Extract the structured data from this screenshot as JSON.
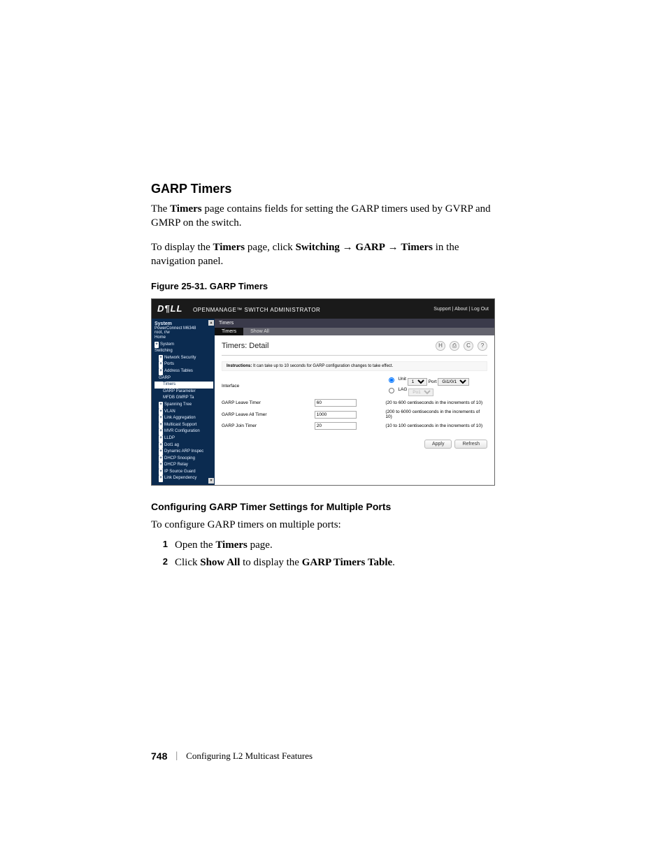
{
  "heading_section": "GARP Timers",
  "para1_pre": "The ",
  "para1_b1": "Timers",
  "para1_mid": " page contains fields for setting the GARP timers used by GVRP and GMRP on the switch.",
  "para2_pre": "To display the ",
  "para2_b1": "Timers",
  "para2_mid1": " page, click ",
  "para2_b2": "Switching",
  "para2_arrow1": " → ",
  "para2_b3": "GARP",
  "para2_arrow2": " → ",
  "para2_b4": "Timers",
  "para2_end": " in the navigation panel.",
  "figure_caption": "Figure 25-31.    GARP Timers",
  "ss": {
    "logo": "D¶LL",
    "app": "OPENMANAGE™ SWITCH ADMINISTRATOR",
    "toplinks": "Support  |  About  |  Log Out",
    "nav_header_sys": "System",
    "nav_header_model": "PowerConnect M6348",
    "nav_header_user": "root, r/w",
    "nav_items": [
      {
        "label": "Home",
        "indent": 0,
        "plus": false,
        "selected": false
      },
      {
        "label": "System",
        "indent": 0,
        "plus": true,
        "selected": false
      },
      {
        "label": "Switching",
        "indent": 0,
        "plus": false,
        "selected": false
      },
      {
        "label": "Network Security",
        "indent": 1,
        "plus": true,
        "selected": false
      },
      {
        "label": "Ports",
        "indent": 1,
        "plus": true,
        "selected": false
      },
      {
        "label": "Address Tables",
        "indent": 1,
        "plus": true,
        "selected": false
      },
      {
        "label": "GARP",
        "indent": 1,
        "plus": false,
        "selected": false
      },
      {
        "label": "Timers",
        "indent": 2,
        "plus": false,
        "selected": true
      },
      {
        "label": "GARP Parameter",
        "indent": 2,
        "plus": false,
        "selected": false
      },
      {
        "label": "MFDB GMRP Ta",
        "indent": 2,
        "plus": false,
        "selected": false
      },
      {
        "label": "Spanning Tree",
        "indent": 1,
        "plus": true,
        "selected": false
      },
      {
        "label": "VLAN",
        "indent": 1,
        "plus": true,
        "selected": false
      },
      {
        "label": "Link Aggregation",
        "indent": 1,
        "plus": true,
        "selected": false
      },
      {
        "label": "Multicast Support",
        "indent": 1,
        "plus": true,
        "selected": false
      },
      {
        "label": "MVR Configuration",
        "indent": 1,
        "plus": true,
        "selected": false
      },
      {
        "label": "LLDP",
        "indent": 1,
        "plus": true,
        "selected": false
      },
      {
        "label": "Dot1 ag",
        "indent": 1,
        "plus": true,
        "selected": false
      },
      {
        "label": "Dynamic ARP Inspec",
        "indent": 1,
        "plus": true,
        "selected": false
      },
      {
        "label": "DHCP Snooping",
        "indent": 1,
        "plus": true,
        "selected": false
      },
      {
        "label": "DHCP Relay",
        "indent": 1,
        "plus": true,
        "selected": false
      },
      {
        "label": "IP Source Guard",
        "indent": 1,
        "plus": true,
        "selected": false
      },
      {
        "label": "Link Dependency",
        "indent": 1,
        "plus": true,
        "selected": false
      }
    ],
    "breadcrumb": "Timers",
    "tabs": {
      "active": "Timers",
      "other": "Show All"
    },
    "panel_title": "Timers: Detail",
    "panel_icons": {
      "save": "H",
      "print": "⎙",
      "refresh": "C",
      "help": "?"
    },
    "instructions_label": "Instructions:",
    "instructions_text": " It can take up to 10 seconds for GARP configuration changes to take effect.",
    "row_iface_label": "Interface",
    "row_iface_unit_radio": "Unit",
    "row_iface_unit_value": "1",
    "row_iface_port_label": "Port",
    "row_iface_port_value": "Gi1/0/1",
    "row_iface_lag_radio": "LAG",
    "row_iface_lag_value": "Po1",
    "row_leave_label": "GARP Leave Timer",
    "row_leave_value": "60",
    "row_leave_hint": "(20 to 600 centiseconds in the increments of 10)",
    "row_leaveall_label": "GARP Leave All Timer",
    "row_leaveall_value": "1000",
    "row_leaveall_hint": "(200 to 6000 centiseconds in the increments of 10)",
    "row_join_label": "GARP Join Timer",
    "row_join_value": "20",
    "row_join_hint": "(10 to 100 centiseconds in the increments of 10)",
    "btn_apply": "Apply",
    "btn_refresh": "Refresh"
  },
  "subheading": "Configuring GARP Timer Settings for Multiple Ports",
  "subpara": "To configure GARP timers on multiple ports:",
  "step1_num": "1",
  "step1_pre": "Open the ",
  "step1_b1": "Timers",
  "step1_end": " page.",
  "step2_num": "2",
  "step2_pre": "Click ",
  "step2_b1": "Show All",
  "step2_mid": " to display the ",
  "step2_b2": "GARP Timers Table",
  "step2_end": ".",
  "footer_page": "748",
  "footer_title": "Configuring L2 Multicast Features"
}
